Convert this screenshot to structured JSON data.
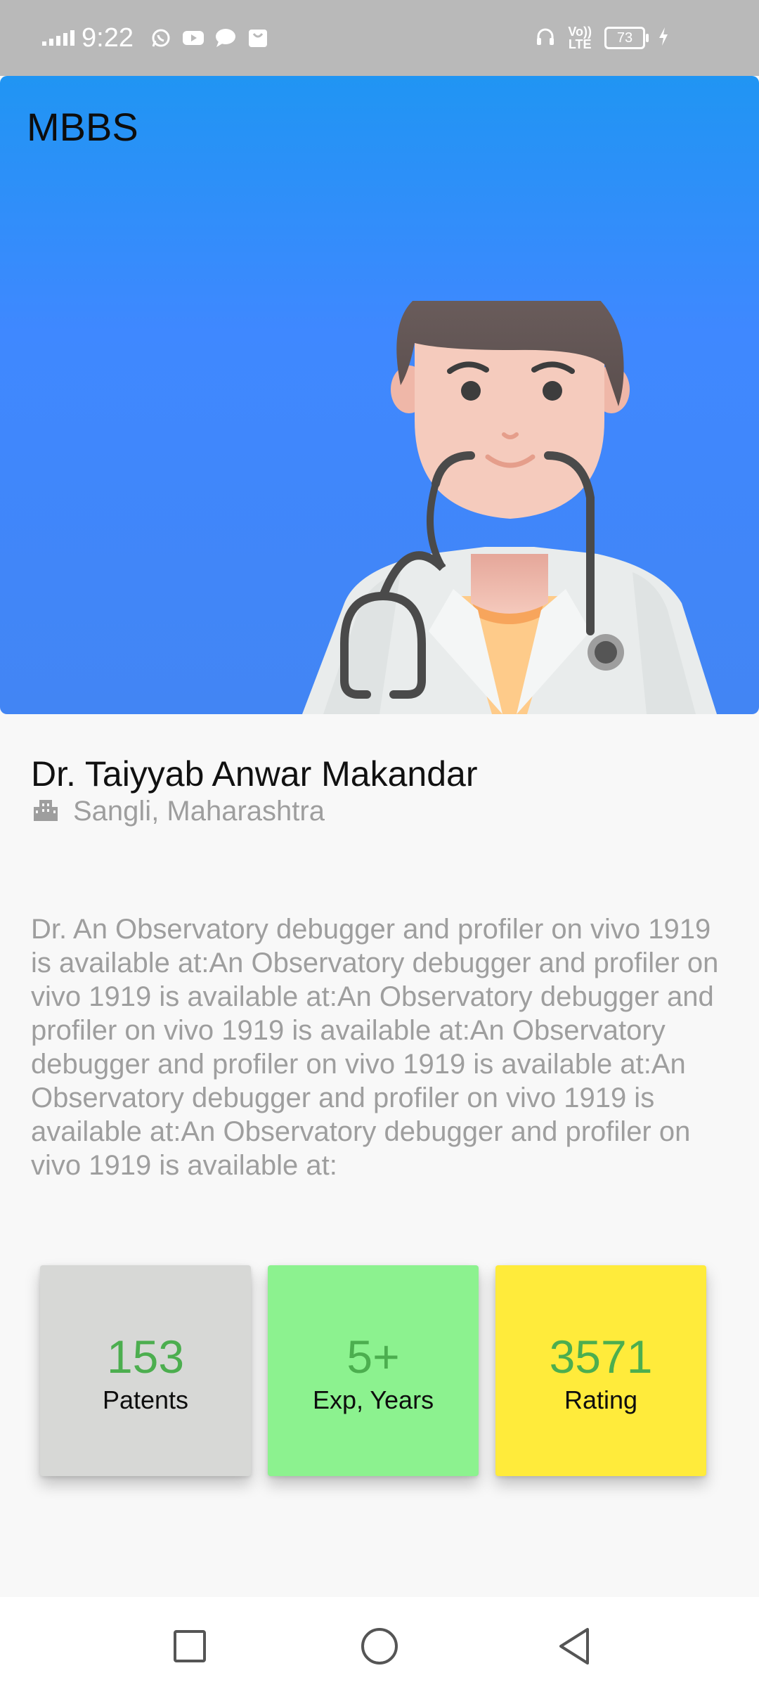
{
  "status_bar": {
    "time": "9:22",
    "notification_icons": [
      "whatsapp-icon",
      "youtube-icon",
      "message-icon",
      "shopping-bag-icon"
    ],
    "volte_line1": "Vo))",
    "volte_line2": "LTE",
    "battery_level": "73"
  },
  "hero": {
    "title": "MBBS",
    "gradient_top": "#2095f3",
    "gradient_bottom": "#4285f4"
  },
  "doctor": {
    "name": "Dr. Taiyyab Anwar Makandar",
    "location": "Sangli, Maharashtra",
    "description": "Dr. An Observatory debugger and profiler on vivo 1919 is available at:An Observatory debugger and profiler on vivo 1919 is available at:An Observatory debugger and profiler on vivo 1919 is available at:An Observatory debugger and profiler on vivo 1919 is available at:An Observatory debugger and profiler on vivo 1919 is available at:An Observatory debugger and profiler on vivo 1919 is available at:"
  },
  "stats": [
    {
      "value": "153",
      "label": "Patents",
      "color": "#d7d8d6"
    },
    {
      "value": "5+",
      "label": "Exp, Years",
      "color": "#8cf28f"
    },
    {
      "value": "3571",
      "label": "Rating",
      "color": "#ffeb3b"
    }
  ],
  "nav": {
    "buttons": [
      "recents-square-icon",
      "home-circle-icon",
      "back-triangle-icon"
    ]
  }
}
